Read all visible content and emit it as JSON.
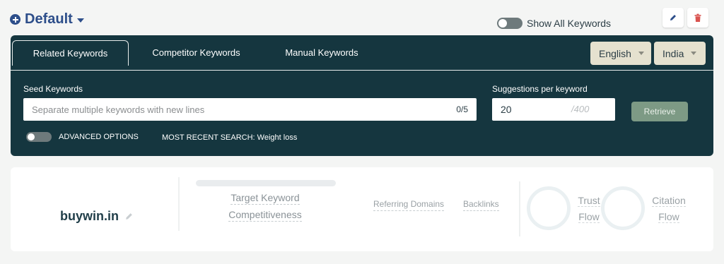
{
  "header": {
    "profile_name": "Default",
    "show_all_label": "Show All Keywords"
  },
  "tabs": [
    {
      "label": "Related Keywords",
      "active": true
    },
    {
      "label": "Competitor Keywords",
      "active": false
    },
    {
      "label": "Manual Keywords",
      "active": false
    }
  ],
  "language": {
    "selected": "English"
  },
  "country": {
    "selected": "India"
  },
  "seed": {
    "label": "Seed Keywords",
    "placeholder": "Separate multiple keywords with new lines",
    "count": "0/5"
  },
  "suggestions": {
    "label": "Suggestions per keyword",
    "value": "20",
    "max": "/400"
  },
  "retrieve_label": "Retrieve",
  "advanced_label": "ADVANCED OPTIONS",
  "recent_search": "MOST RECENT SEARCH: Weight loss",
  "result": {
    "domain": "buywin.in",
    "target_keyword_line1": "Target Keyword",
    "target_keyword_line2": "Competitiveness",
    "referring_domains": "Referring Domains",
    "backlinks": "Backlinks",
    "trust_flow_line1": "Trust",
    "trust_flow_line2": "Flow",
    "citation_flow_line1": "Citation",
    "citation_flow_line2": "Flow"
  },
  "colors": {
    "panel": "#15363f",
    "accent_blue": "#2d4e8a",
    "select_bg": "#e5e1cf",
    "retrieve_bg": "#7d9a85",
    "delete_red": "#d9534f"
  }
}
